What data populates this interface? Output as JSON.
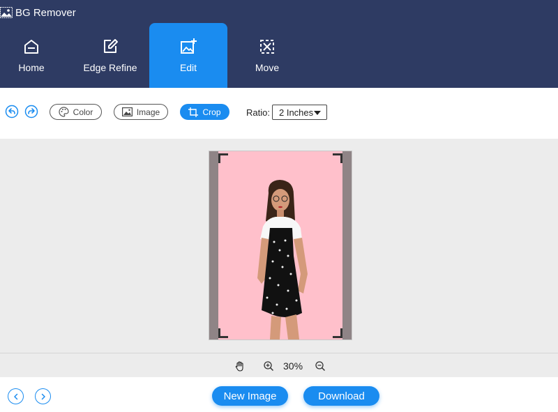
{
  "app": {
    "title": "BG Remover",
    "logo_icon": "image-logo-icon"
  },
  "nav": {
    "items": [
      {
        "label": "Home",
        "icon": "home-icon",
        "active": false
      },
      {
        "label": "Edge Refine",
        "icon": "edit-pencil-icon",
        "active": false
      },
      {
        "label": "Edit",
        "icon": "image-edit-icon",
        "active": true
      },
      {
        "label": "Move",
        "icon": "move-arrows-icon",
        "active": false
      }
    ]
  },
  "toolbar": {
    "undo_icon": "undo-icon",
    "redo_icon": "redo-icon",
    "color_label": "Color",
    "image_label": "Image",
    "crop_label": "Crop",
    "ratio_label": "Ratio:",
    "ratio_value": "2 Inches"
  },
  "zoom": {
    "value": "30%",
    "pan_icon": "hand-icon",
    "zoom_in_icon": "zoom-in-icon",
    "zoom_out_icon": "zoom-out-icon"
  },
  "footer": {
    "new_image_label": "New Image",
    "download_label": "Download",
    "prev_icon": "chevron-left-icon",
    "next_icon": "chevron-right-icon"
  },
  "colors": {
    "header_bg": "#2e3b63",
    "accent": "#1a8cf0",
    "canvas_bg": "#ffc0cb",
    "workspace_bg": "#ececec"
  }
}
